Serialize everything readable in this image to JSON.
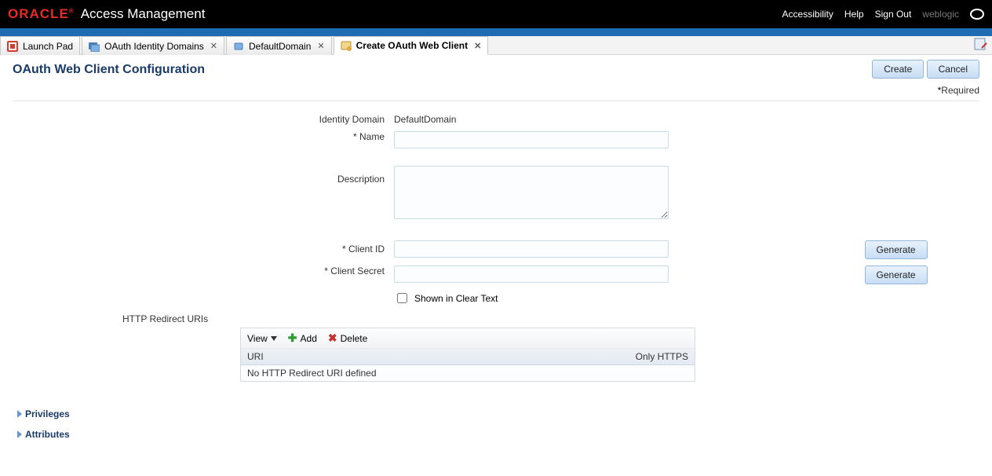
{
  "header": {
    "brand": "ORACLE",
    "app_title": "Access Management",
    "links": {
      "accessibility": "Accessibility",
      "help": "Help",
      "sign_out": "Sign Out"
    },
    "user": "weblogic"
  },
  "tabs": [
    {
      "label": "Launch Pad",
      "closable": false
    },
    {
      "label": "OAuth Identity Domains",
      "closable": true
    },
    {
      "label": "DefaultDomain",
      "closable": true
    },
    {
      "label": "Create OAuth Web Client",
      "closable": true,
      "active": true
    }
  ],
  "page": {
    "title": "OAuth Web Client Configuration",
    "required_text": "Required",
    "buttons": {
      "create": "Create",
      "cancel": "Cancel"
    }
  },
  "form": {
    "identity_domain": {
      "label": "Identity Domain",
      "value": "DefaultDomain"
    },
    "name": {
      "label": "Name",
      "value": ""
    },
    "description": {
      "label": "Description",
      "value": ""
    },
    "client_id": {
      "label": "Client ID",
      "value": "",
      "generate": "Generate"
    },
    "client_secret": {
      "label": "Client Secret",
      "value": "",
      "generate": "Generate"
    },
    "shown_clear": {
      "label": "Shown in Clear Text",
      "checked": false
    },
    "redirect": {
      "label": "HTTP Redirect URIs"
    }
  },
  "uri_table": {
    "view": "View",
    "add": "Add",
    "delete": "Delete",
    "col_uri": "URI",
    "col_https": "Only HTTPS",
    "empty": "No HTTP Redirect URI defined"
  },
  "sections": {
    "privileges": "Privileges",
    "attributes": "Attributes"
  }
}
